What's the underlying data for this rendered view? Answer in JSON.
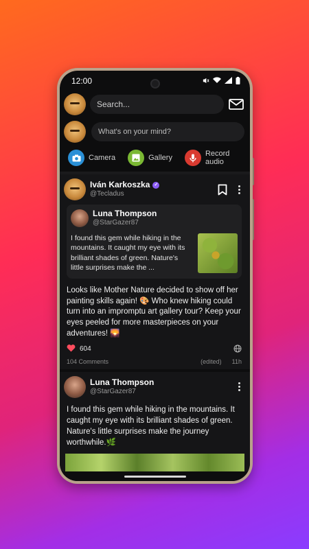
{
  "status": {
    "time": "12:00"
  },
  "search": {
    "placeholder": "Search..."
  },
  "compose": {
    "placeholder": "What's on your mind?"
  },
  "actions": [
    {
      "label": "Camera",
      "icon": "camera-icon",
      "color": "#2a8fd6"
    },
    {
      "label": "Gallery",
      "icon": "gallery-icon",
      "color": "#7ab833"
    },
    {
      "label": "Record audio",
      "icon": "mic-icon",
      "color": "#d93a30"
    }
  ],
  "post1": {
    "author": "Iván Karkoszka",
    "handle": "@Tecladus",
    "quote": {
      "author": "Luna Thompson",
      "handle": "@StarGazer87",
      "text": "I found this gem while hiking in the mountains. It caught my eye with its brilliant shades of green. Nature's little surprises make the ..."
    },
    "text": "Looks like Mother Nature decided to show off her painting skills again! 🎨 Who knew hiking could turn into an impromptu art gallery tour? Keep your eyes peeled for more masterpieces on your adventures! 🌄",
    "likes": "604",
    "comments": "104 Comments",
    "edited": "(edited)",
    "time": "11h"
  },
  "post2": {
    "author": "Luna Thompson",
    "handle": "@StarGazer87",
    "text": "I found this gem while hiking in the mountains. It caught my eye with its brilliant shades of green. Nature's little surprises make the journey worthwhile.🌿"
  }
}
